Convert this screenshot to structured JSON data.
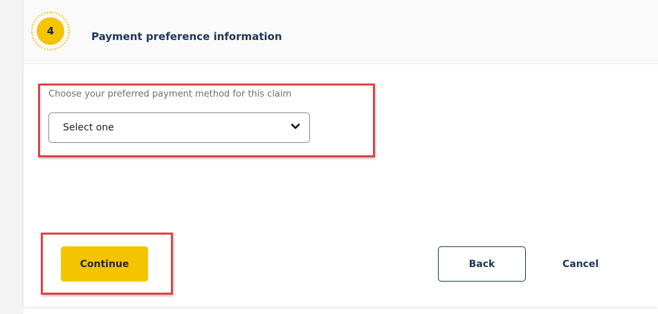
{
  "step": {
    "number": "4",
    "title": "Payment preference information"
  },
  "payment": {
    "label": "Choose your preferred payment method for this claim",
    "selected": "Select one"
  },
  "actions": {
    "continue_label": "Continue",
    "back_label": "Back",
    "cancel_label": "Cancel"
  },
  "colors": {
    "accent_yellow": "#f5c400",
    "text_navy": "#1d3557",
    "highlight_red": "#e0424a"
  }
}
